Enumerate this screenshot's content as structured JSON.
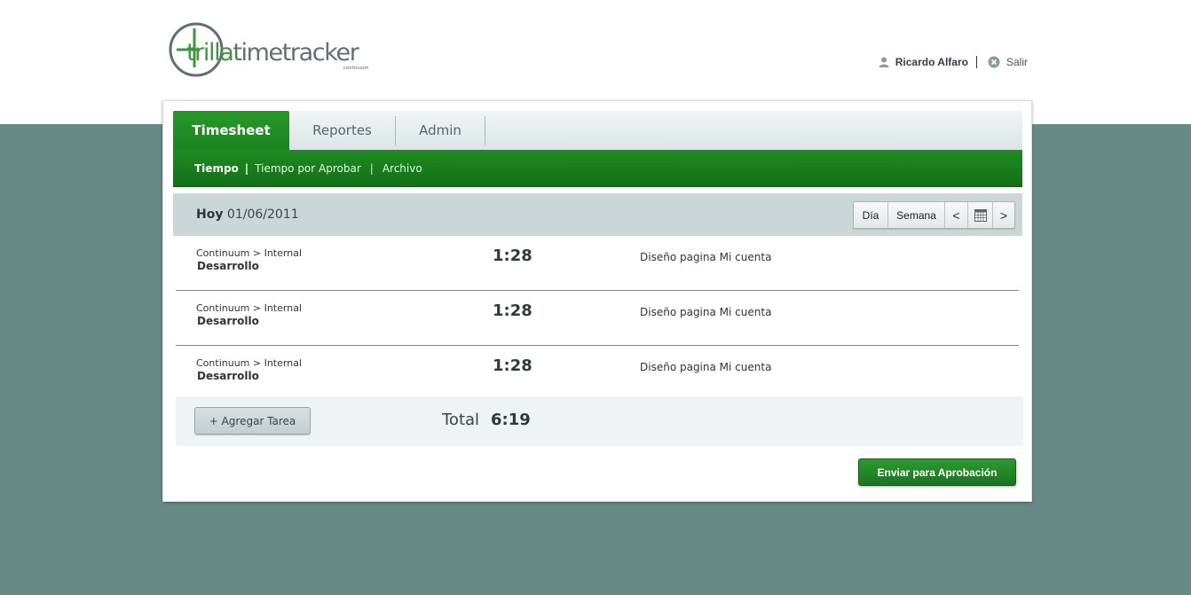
{
  "header": {
    "logo_brand": "trilla",
    "logo_product": "timetracker",
    "logo_sub": "continuum",
    "user_icon": "user-icon",
    "user_name": "Ricardo Alfaro",
    "exit_icon": "close-circle-icon",
    "exit_label": "Salir"
  },
  "tabs": [
    {
      "label": "Timesheet",
      "active": true
    },
    {
      "label": "Reportes",
      "active": false
    },
    {
      "label": "Admin",
      "active": false
    }
  ],
  "subnav": [
    {
      "label": "Tiempo",
      "current": true
    },
    {
      "label": "Tiempo por Aprobar",
      "current": false
    },
    {
      "label": "Archivo",
      "current": false
    }
  ],
  "datebar": {
    "today_label": "Hoy",
    "date": "01/06/2011",
    "controls": {
      "day": "Día",
      "week": "Semana",
      "prev": "<",
      "calendar_icon": "calendar-icon",
      "next": ">"
    }
  },
  "entries": [
    {
      "client": "Continuum > Internal",
      "task": "Desarrollo",
      "duration": "1:28",
      "description": "Diseño pagina Mi cuenta"
    },
    {
      "client": "Continuum > Internal",
      "task": "Desarrollo",
      "duration": "1:28",
      "description": "Diseño pagina Mi cuenta"
    },
    {
      "client": "Continuum > Internal",
      "task": "Desarrollo",
      "duration": "1:28",
      "description": "Diseño pagina Mi cuenta"
    }
  ],
  "footer": {
    "add_task": "+ Agregar Tarea",
    "total_label": "Total",
    "total_value": "6:19",
    "submit": "Enviar para Aprobación"
  },
  "colors": {
    "brand_green": "#1b8522",
    "background": "#688a87",
    "accent_grey": "#cbd6d7"
  }
}
